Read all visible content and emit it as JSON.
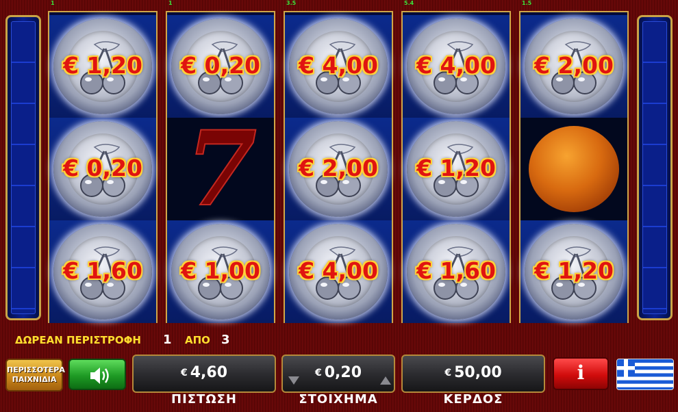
{
  "top_counters": [
    "1",
    "1",
    "3.5",
    "5.4",
    "1.5"
  ],
  "reels": [
    [
      {
        "type": "cherry-coin",
        "prize": "€ 1,20"
      },
      {
        "type": "cherry-coin",
        "prize": "€ 0,20"
      },
      {
        "type": "cherry-coin",
        "prize": "€ 1,60"
      }
    ],
    [
      {
        "type": "cherry-coin",
        "prize": "€ 0,20"
      },
      {
        "type": "seven"
      },
      {
        "type": "cherry-coin",
        "prize": "€ 1,00"
      }
    ],
    [
      {
        "type": "cherry-coin",
        "prize": "€ 4,00"
      },
      {
        "type": "cherry-coin",
        "prize": "€ 2,00"
      },
      {
        "type": "cherry-coin",
        "prize": "€ 4,00"
      }
    ],
    [
      {
        "type": "cherry-coin",
        "prize": "€ 4,00"
      },
      {
        "type": "cherry-coin",
        "prize": "€ 1,20"
      },
      {
        "type": "cherry-coin",
        "prize": "€ 1,60"
      }
    ],
    [
      {
        "type": "cherry-coin",
        "prize": "€ 2,00"
      },
      {
        "type": "orange"
      },
      {
        "type": "cherry-coin",
        "prize": "€ 1,20"
      }
    ]
  ],
  "free_spins": {
    "label": "ΔΩΡΕΑΝ ΠΕΡΙΣΤΡΟΦΗ",
    "current": "1",
    "of_label": "ΑΠΟ",
    "total": "3"
  },
  "buttons": {
    "more_games_line1": "ΠΕΡΙΣΣΟΤΕΡΑ",
    "more_games_line2": "ΠΑΙΧΝΙΔΙΑ",
    "sound_icon": "speaker-icon",
    "info_label": "i",
    "language_icon": "greek-flag-icon"
  },
  "balance": {
    "currency": "€",
    "value": "4,60",
    "label": "ΠΙΣΤΩΣΗ"
  },
  "bet": {
    "currency": "€",
    "value": "0,20",
    "label": "ΣΤΟΙΧΗΜΑ"
  },
  "win": {
    "currency": "€",
    "value": "50,00",
    "label": "ΚΕΡΔΟΣ"
  },
  "colors": {
    "prize_text": "#e01410",
    "prize_outline": "#ffd23a",
    "frame_gold": "#d0a748",
    "label_yellow": "#ffde2e"
  }
}
